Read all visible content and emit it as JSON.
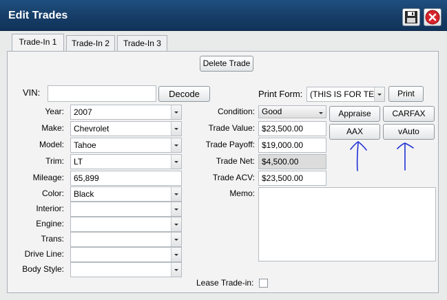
{
  "window": {
    "title": "Edit Trades",
    "save_icon": "floppy-disk-icon",
    "close_icon": "close-icon"
  },
  "tabs": [
    {
      "label": "Trade-In 1",
      "active": true
    },
    {
      "label": "Trade-In 2",
      "active": false
    },
    {
      "label": "Trade-In 3",
      "active": false
    }
  ],
  "actions": {
    "delete_trade": "Delete Trade",
    "decode": "Decode",
    "print": "Print",
    "appraise": "Appraise",
    "carfax": "CARFAX",
    "aax": "AAX",
    "vauto": "vAuto"
  },
  "vin": {
    "label": "VIN:",
    "value": ""
  },
  "print_form": {
    "label": "Print Form:",
    "value": "(THIS IS FOR TE"
  },
  "vehicle": {
    "year": {
      "label": "Year:",
      "value": "2007"
    },
    "make": {
      "label": "Make:",
      "value": "Chevrolet"
    },
    "model": {
      "label": "Model:",
      "value": "Tahoe"
    },
    "trim": {
      "label": "Trim:",
      "value": "LT"
    },
    "mileage": {
      "label": "Mileage:",
      "value": "65,899"
    },
    "color": {
      "label": "Color:",
      "value": "Black"
    },
    "interior": {
      "label": "Interior:",
      "value": ""
    },
    "engine": {
      "label": "Engine:",
      "value": ""
    },
    "trans": {
      "label": "Trans:",
      "value": ""
    },
    "drive_line": {
      "label": "Drive Line:",
      "value": ""
    },
    "body_style": {
      "label": "Body Style:",
      "value": ""
    }
  },
  "trade": {
    "condition": {
      "label": "Condition:",
      "value": "Good"
    },
    "trade_value": {
      "label": "Trade Value:",
      "value": "$23,500.00"
    },
    "trade_payoff": {
      "label": "Trade Payoff:",
      "value": "$19,000.00"
    },
    "trade_net": {
      "label": "Trade Net:",
      "value": "$4,500.00"
    },
    "trade_acv": {
      "label": "Trade ACV:",
      "value": "$23,500.00"
    },
    "memo": {
      "label": "Memo:",
      "value": ""
    },
    "lease_trade_in": {
      "label": "Lease Trade-in:",
      "checked": false
    }
  },
  "colors": {
    "titlebar": "#1a4672",
    "annotation": "#1f2fd6"
  }
}
